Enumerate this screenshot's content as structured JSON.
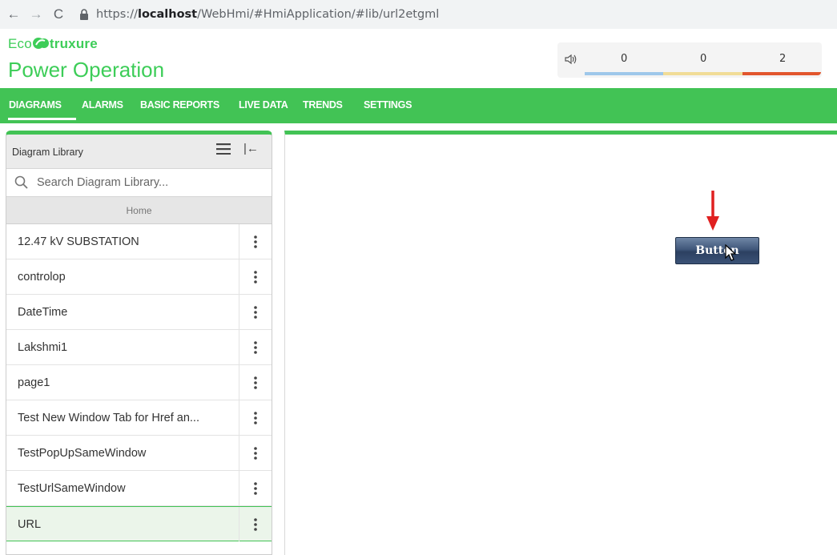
{
  "browser": {
    "back": "←",
    "forward": "→",
    "reload": "C",
    "url_prefix": "https://",
    "url_host": "localhost",
    "url_path": "/WebHmi/#HmiApplication/#lib/url2etgml",
    "icons": [
      "back-arrow-icon",
      "forward-arrow-icon",
      "reload-icon",
      "lock-icon"
    ]
  },
  "header": {
    "brand_pre": "Eco",
    "brand_post": "truxure",
    "product": "Power Operation"
  },
  "alarms": {
    "counts": [
      "0",
      "0",
      "2"
    ],
    "colors": [
      "#9ec7ea",
      "#f1dc97",
      "#e2562d"
    ]
  },
  "nav": {
    "tabs": [
      "DIAGRAMS",
      "ALARMS",
      "BASIC REPORTS",
      "LIVE DATA",
      "TRENDS",
      "SETTINGS"
    ],
    "active": "DIAGRAMS",
    "accent": "#42c355"
  },
  "library": {
    "title": "Diagram Library",
    "search_placeholder": "Search Diagram Library...",
    "home_label": "Home",
    "items": [
      "12.47 kV SUBSTATION",
      "controlop",
      "DateTime",
      "Lakshmi1",
      "page1",
      "Test New Window Tab for Href an...",
      "TestPopUpSameWindow",
      "TestUrlSameWindow",
      "URL"
    ],
    "selected": "URL"
  },
  "canvas": {
    "button_label": "Button"
  }
}
